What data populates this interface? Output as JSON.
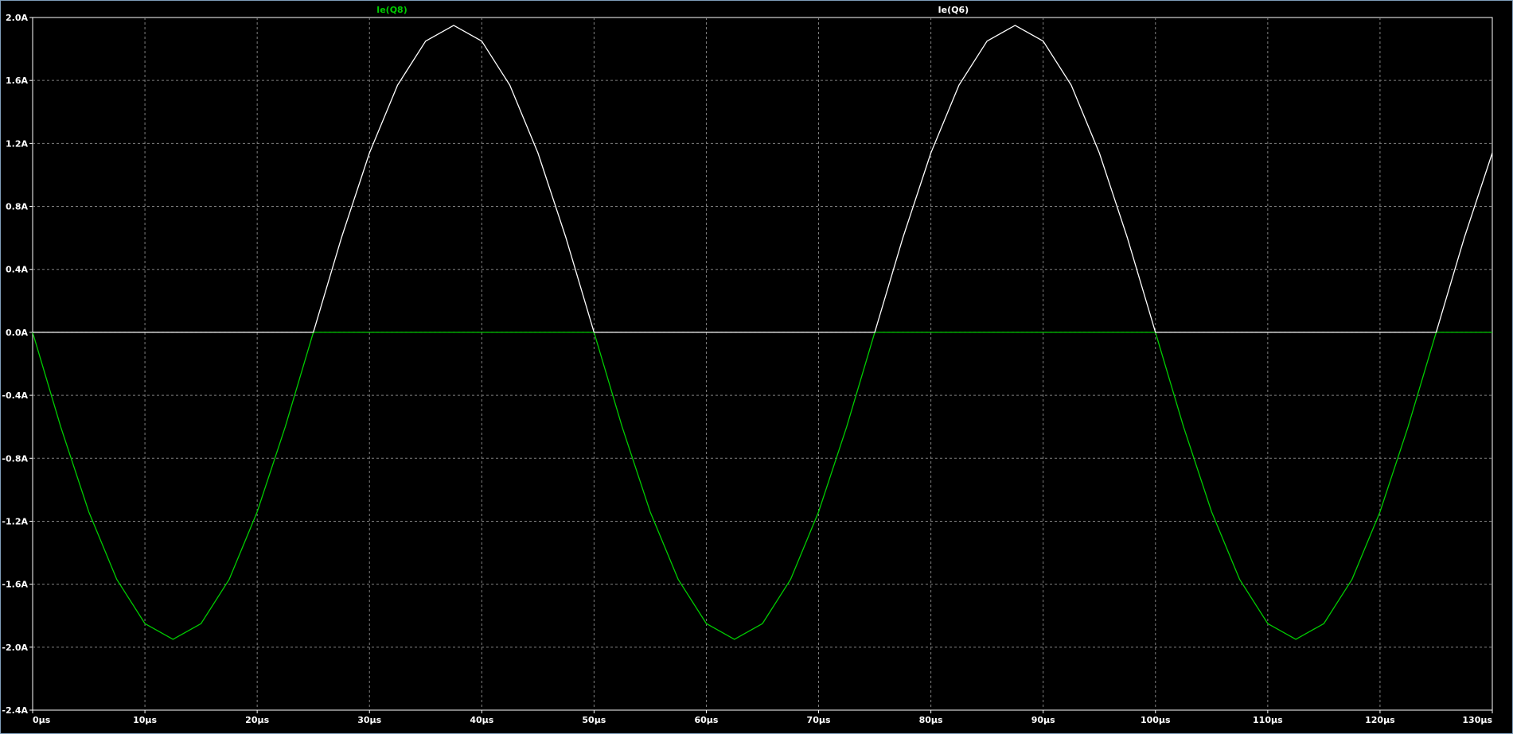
{
  "window": {
    "background": "#000000",
    "frame_color": "#7f9db9"
  },
  "plot": {
    "grid_color": "#808080",
    "axis_color": "#ffffff"
  },
  "chart_data": {
    "type": "line",
    "title": "",
    "xlabel": "",
    "ylabel": "",
    "grid": true,
    "legend": "top",
    "xlim": [
      0,
      130
    ],
    "ylim": [
      -2.4,
      2.0
    ],
    "x_unit": "µs",
    "y_unit": "A",
    "x_ticks": [
      0,
      10,
      20,
      30,
      40,
      50,
      60,
      70,
      80,
      90,
      100,
      110,
      120,
      130
    ],
    "x_tick_labels": [
      "0µs",
      "10µs",
      "20µs",
      "30µs",
      "40µs",
      "50µs",
      "60µs",
      "70µs",
      "80µs",
      "90µs",
      "100µs",
      "110µs",
      "120µs",
      "130µs"
    ],
    "y_ticks": [
      2.0,
      1.6,
      1.2,
      0.8,
      0.4,
      0.0,
      -0.4,
      -0.8,
      -1.2,
      -1.6,
      -2.0,
      -2.4
    ],
    "y_tick_labels": [
      "2.0A",
      "1.6A",
      "1.2A",
      "0.8A",
      "0.4A",
      "0.0A",
      "-0.4A",
      "-0.8A",
      "-1.2A",
      "-1.6A",
      "-2.0A",
      "-2.4A"
    ],
    "series": [
      {
        "name": "Ie(Q8)",
        "color": "#00cc00",
        "label_at_x": 32,
        "points": [
          [
            0,
            0
          ],
          [
            2.5,
            -0.6
          ],
          [
            5,
            -1.14
          ],
          [
            7.5,
            -1.57
          ],
          [
            10,
            -1.85
          ],
          [
            12.5,
            -1.95
          ],
          [
            15,
            -1.85
          ],
          [
            17.5,
            -1.57
          ],
          [
            20,
            -1.14
          ],
          [
            22.5,
            -0.6
          ],
          [
            25,
            0
          ],
          [
            37.5,
            0
          ],
          [
            50,
            0
          ],
          [
            52.5,
            -0.6
          ],
          [
            55,
            -1.14
          ],
          [
            57.5,
            -1.57
          ],
          [
            60,
            -1.85
          ],
          [
            62.5,
            -1.95
          ],
          [
            65,
            -1.85
          ],
          [
            67.5,
            -1.57
          ],
          [
            70,
            -1.14
          ],
          [
            72.5,
            -0.6
          ],
          [
            75,
            0
          ],
          [
            87.5,
            0
          ],
          [
            100,
            0
          ],
          [
            102.5,
            -0.6
          ],
          [
            105,
            -1.14
          ],
          [
            107.5,
            -1.57
          ],
          [
            110,
            -1.85
          ],
          [
            112.5,
            -1.95
          ],
          [
            115,
            -1.85
          ],
          [
            117.5,
            -1.57
          ],
          [
            120,
            -1.14
          ],
          [
            122.5,
            -0.6
          ],
          [
            125,
            0
          ],
          [
            130,
            0
          ]
        ]
      },
      {
        "name": "Ie(Q6)",
        "color": "#ffffff",
        "label_at_x": 82,
        "points": [
          [
            0,
            0
          ],
          [
            12.5,
            0
          ],
          [
            25,
            0
          ],
          [
            27.5,
            0.6
          ],
          [
            30,
            1.14
          ],
          [
            32.5,
            1.57
          ],
          [
            35,
            1.85
          ],
          [
            37.5,
            1.95
          ],
          [
            40,
            1.85
          ],
          [
            42.5,
            1.57
          ],
          [
            45,
            1.14
          ],
          [
            47.5,
            0.6
          ],
          [
            50,
            0
          ],
          [
            62.5,
            0
          ],
          [
            75,
            0
          ],
          [
            77.5,
            0.6
          ],
          [
            80,
            1.14
          ],
          [
            82.5,
            1.57
          ],
          [
            85,
            1.85
          ],
          [
            87.5,
            1.95
          ],
          [
            90,
            1.85
          ],
          [
            92.5,
            1.57
          ],
          [
            95,
            1.14
          ],
          [
            97.5,
            0.6
          ],
          [
            100,
            0
          ],
          [
            112.5,
            0
          ],
          [
            125,
            0
          ],
          [
            127.5,
            0.6
          ],
          [
            130,
            1.14
          ]
        ]
      }
    ]
  }
}
